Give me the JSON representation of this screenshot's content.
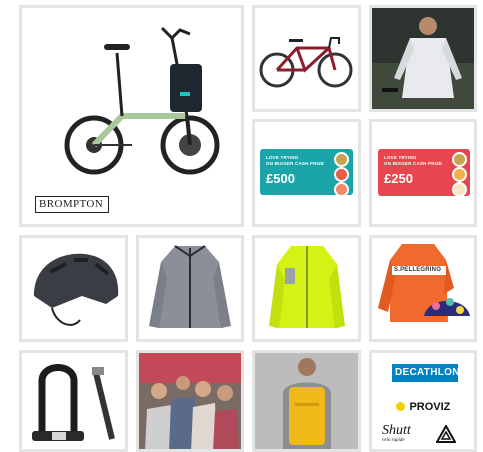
{
  "tiles": {
    "brompton": {
      "logo_text": "BROMPTON"
    },
    "voucher_500": {
      "fine_line1": "LOVE TRYING",
      "fine_line2": "ON BIGGER CASH PRIZE",
      "amount": "£500",
      "color": "#1ba5a8"
    },
    "voucher_250": {
      "fine_line1": "LOVE TRYING",
      "fine_line2": "ON BIGGER CASH PRIZE",
      "amount": "£250",
      "color": "#e8464e"
    },
    "jersey": {
      "chest_text": "S.PELLEGRINO"
    },
    "sponsors": {
      "decathlon": "DECATHLON",
      "proviz": "PROVIZ",
      "shutt": "Shutt",
      "shutt_tag": "velo rapide",
      "decathlon_color": "#0082c3"
    }
  }
}
